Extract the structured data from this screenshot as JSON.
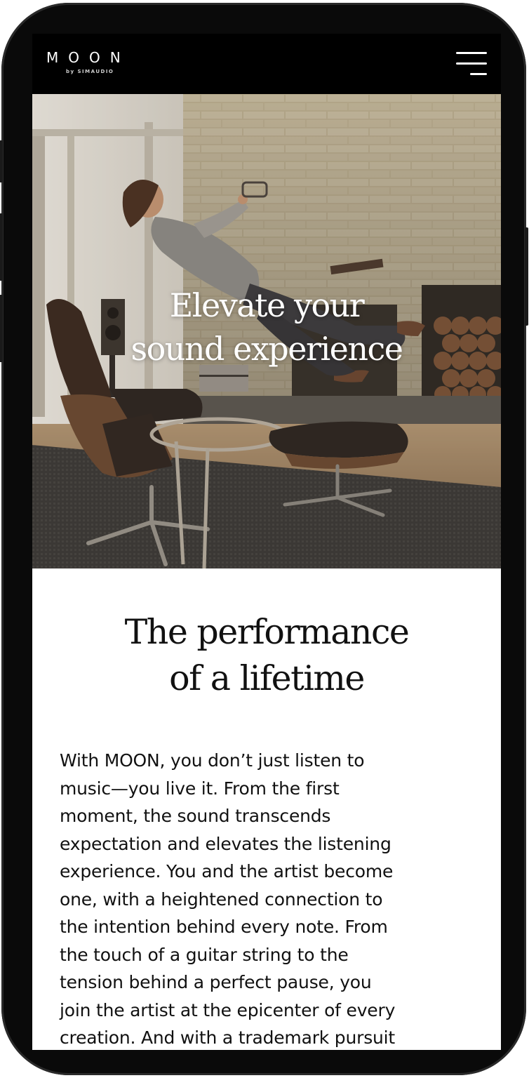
{
  "header": {
    "logo": "MOON",
    "logo_sub": "by SIMAUDIO",
    "menu_icon": "hamburger-menu-icon"
  },
  "hero": {
    "title_lines": [
      "Elevate your",
      "sound experience"
    ]
  },
  "intro": {
    "title_lines": [
      "The performance",
      "of a lifetime"
    ],
    "body_lines": [
      "With MOON, you don’t just listen to",
      "music—you live it. From the first",
      "moment, the sound transcends",
      "expectation and elevates the listening",
      "experience. You and the artist become",
      "one, with a heightened connection to",
      "the intention behind every note. From",
      "the touch of a guitar string to the",
      "tension behind a perfect pause, you",
      "join the artist at the epicenter of every",
      "creation. And with a trademark pursuit"
    ]
  },
  "colors": {
    "frame": "#0a0a0a",
    "nav_background": "#000000",
    "page_background": "#ffffff",
    "text": "#111111"
  }
}
